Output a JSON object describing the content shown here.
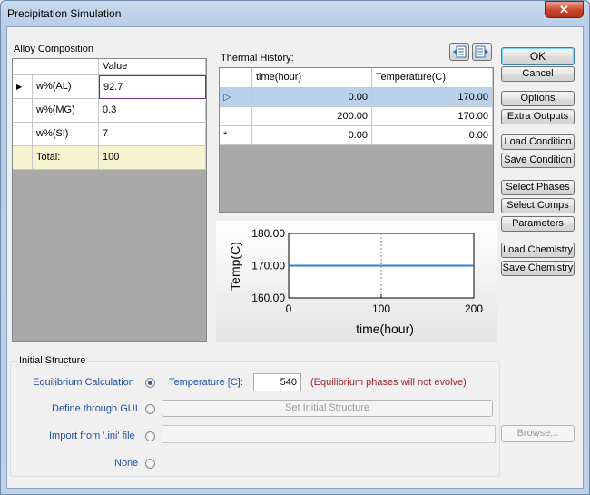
{
  "window": {
    "title": "Precipitation Simulation",
    "close_glyph": "✕"
  },
  "alloy": {
    "group_label": "Alloy Composition",
    "value_header": "Value",
    "rows": [
      {
        "name": "w%(AL)",
        "value": "92.7"
      },
      {
        "name": "w%(MG)",
        "value": "0.3"
      },
      {
        "name": "w%(SI)",
        "value": "7"
      }
    ],
    "total_label": "Total:",
    "total_value": "100",
    "current_row_marker": "▶"
  },
  "thermal": {
    "label": "Thermal History:",
    "col_time": "time(hour)",
    "col_temp": "Temperature(C)",
    "rows": [
      {
        "time": "0.00",
        "temp": "170.00"
      },
      {
        "time": "200.00",
        "temp": "170.00"
      },
      {
        "time": "0.00",
        "temp": "0.00"
      }
    ],
    "current_marker": "▷",
    "new_row_marker": "*",
    "icon_import": "import-table-icon",
    "icon_export": "export-table-icon"
  },
  "chart_data": {
    "type": "line",
    "xlabel": "time(hour)",
    "ylabel": "Temp(C)",
    "xlim": [
      0,
      200
    ],
    "ylim": [
      160,
      180
    ],
    "xticks": [
      "0",
      "100",
      "200"
    ],
    "yticks": [
      "180.00",
      "170.00",
      "160.00"
    ],
    "series": [
      {
        "x": [
          0,
          200
        ],
        "y": [
          170,
          170
        ],
        "color": "#2f7fd8"
      }
    ],
    "grid": "dashed vertical and horizontal at ticks"
  },
  "buttons": {
    "ok": "OK",
    "cancel": "Cancel",
    "options": "Options",
    "extra_outputs": "Extra Outputs",
    "load_condition": "Load Condition",
    "save_condition": "Save Condition",
    "select_phases": "Select Phases",
    "select_comps": "Select Comps",
    "parameters": "Parameters",
    "load_chemistry": "Load Chemistry",
    "save_chemistry": "Save Chemistry"
  },
  "initial_structure": {
    "group_label": "Initial Structure",
    "eq_calc_label": "Equilibrium Calculation",
    "temperature_label": "Temperature [C]:",
    "temperature_value": "540",
    "eq_note": "(Equilibrium phases will not evolve)",
    "gui_label": "Define through GUI",
    "set_initial_button": "Set Initial Structure",
    "import_label": "Import from '.ini' file",
    "browse_button": "Browse...",
    "none_label": "None",
    "note_color": "#a1262b"
  }
}
